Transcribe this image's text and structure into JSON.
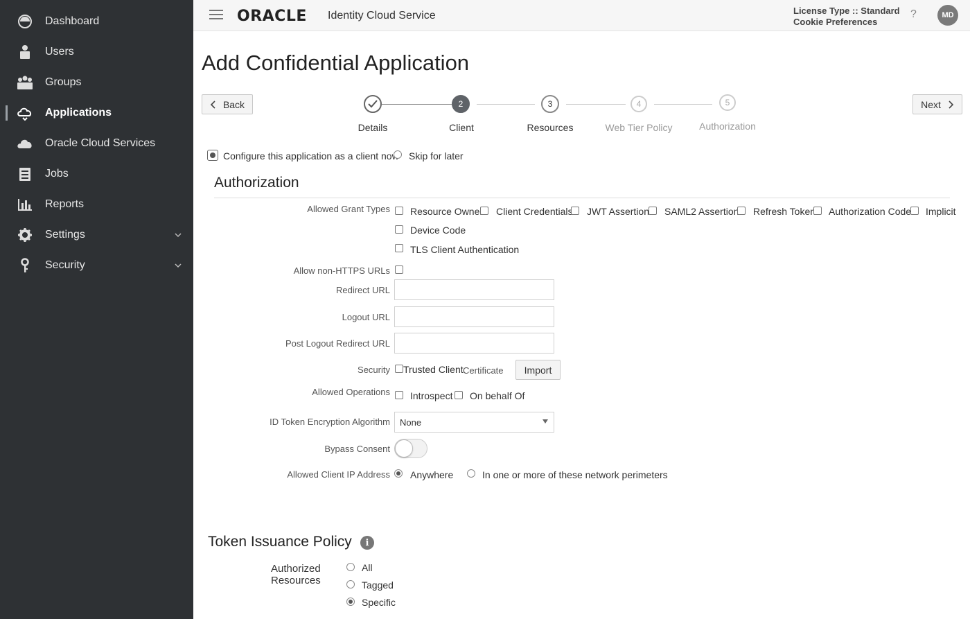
{
  "sidebar": {
    "items": [
      {
        "label": "Dashboard",
        "icon": "dashboard-icon"
      },
      {
        "label": "Users",
        "icon": "user-icon"
      },
      {
        "label": "Groups",
        "icon": "groups-icon"
      },
      {
        "label": "Applications",
        "icon": "applications-icon",
        "active": true
      },
      {
        "label": "Oracle Cloud Services",
        "icon": "cloud-icon"
      },
      {
        "label": "Jobs",
        "icon": "jobs-icon"
      },
      {
        "label": "Reports",
        "icon": "reports-icon"
      },
      {
        "label": "Settings",
        "icon": "gear-icon",
        "expandable": true
      },
      {
        "label": "Security",
        "icon": "key-icon",
        "expandable": true
      }
    ]
  },
  "header": {
    "logo": "ORACLE",
    "service": "Identity Cloud Service",
    "license_line": "License Type :: Standard",
    "cookie_line": "Cookie Preferences",
    "help": "?",
    "avatar_initials": "MD"
  },
  "page": {
    "title": "Add Confidential Application",
    "back_label": "Back",
    "next_label": "Next"
  },
  "stepper": {
    "steps": [
      {
        "label": "Details",
        "number": "✓",
        "state": "done"
      },
      {
        "label": "Client",
        "number": "2",
        "state": "current"
      },
      {
        "label": "Resources",
        "number": "3",
        "state": "upcoming"
      },
      {
        "label": "Web Tier Policy",
        "number": "4",
        "state": "future"
      },
      {
        "label": "Authorization",
        "number": "5",
        "state": "future"
      }
    ]
  },
  "client_config": {
    "configure_now": "Configure this application as a client now",
    "skip": "Skip for later",
    "selected": "configure_now"
  },
  "authorization": {
    "title": "Authorization",
    "grant_types_label": "Allowed Grant Types",
    "grant_types": [
      "Resource Owner",
      "Client Credentials",
      "JWT Assertion",
      "SAML2 Assertion",
      "Refresh Token",
      "Authorization Code",
      "Implicit",
      "Device Code",
      "TLS Client Authentication"
    ],
    "non_https_label": "Allow non-HTTPS URLs",
    "redirect_url_label": "Redirect URL",
    "logout_url_label": "Logout URL",
    "post_logout_label": "Post Logout Redirect URL",
    "security_label": "Security",
    "trusted_client": "Trusted Client",
    "certificate": "Certificate",
    "import_label": "Import",
    "allowed_ops_label": "Allowed Operations",
    "introspect": "Introspect",
    "on_behalf_of": "On behalf Of",
    "id_token_label": "ID Token Encryption Algorithm",
    "id_token_value": "None",
    "bypass_consent_label": "Bypass Consent",
    "bypass_consent_on": false,
    "client_ip_label": "Allowed Client IP Address",
    "ip_anywhere": "Anywhere",
    "ip_perimeters": "In one or more of these network perimeters",
    "ip_selected": "anywhere"
  },
  "token_policy": {
    "title": "Token Issuance Policy",
    "info": "i",
    "authorized_resources_line1": "Authorized",
    "authorized_resources_line2": "Resources",
    "options": [
      "All",
      "Tagged",
      "Specific"
    ],
    "selected": "Specific"
  }
}
